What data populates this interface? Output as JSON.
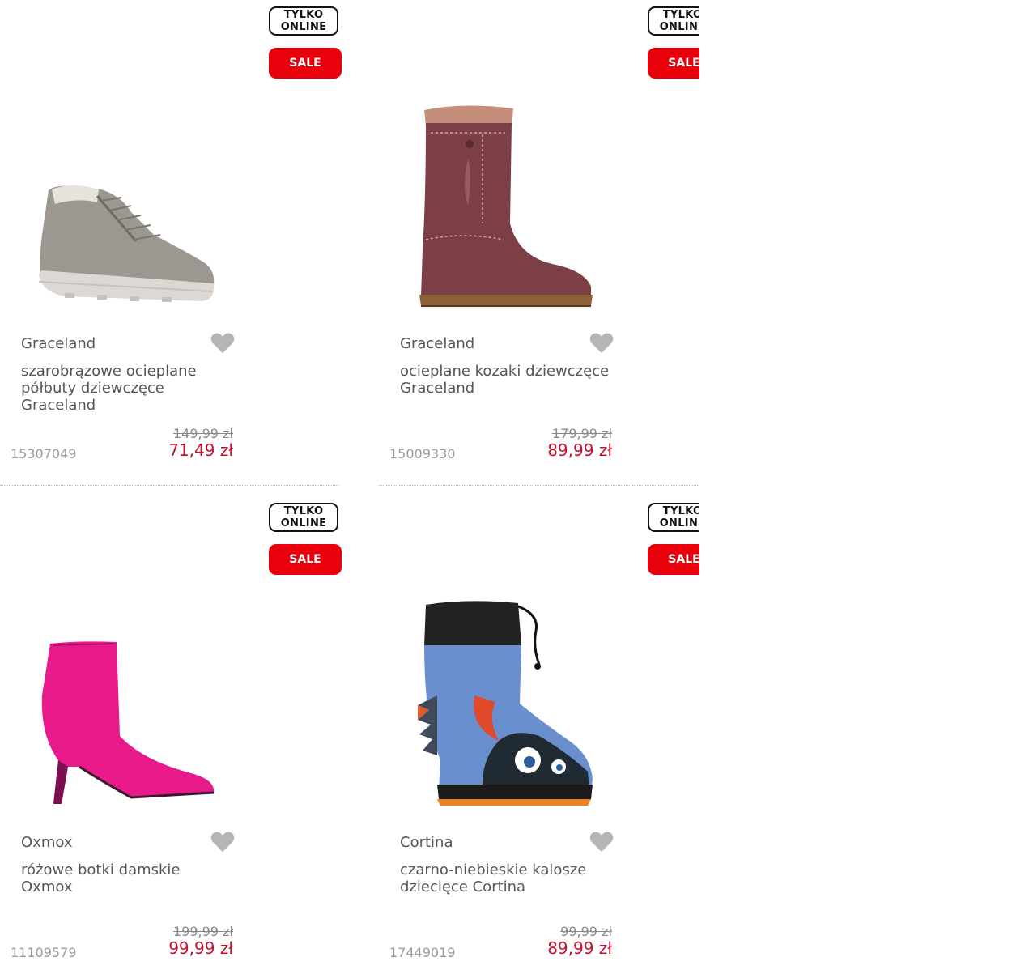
{
  "badges": {
    "online": [
      "TYLKO",
      "ONLINE"
    ],
    "sale": "SALE"
  },
  "products": [
    {
      "brand": "Graceland",
      "name": "szarobrązowe ocieplane półbuty dziewczęce Graceland",
      "old_price": "149,99 zł",
      "new_price": "71,49 zł",
      "sku": "15307049",
      "image": "grey-sneaker-image"
    },
    {
      "brand": "Graceland",
      "name": "ocieplane kozaki dziewczęce Graceland",
      "old_price": "179,99 zł",
      "new_price": "89,99 zł",
      "sku": "15009330",
      "image": "brown-boot-image"
    },
    {
      "brand": "Oxmox",
      "name": "różowe botki damskie Oxmox",
      "old_price": "199,99 zł",
      "new_price": "99,99 zł",
      "sku": "11109579",
      "image": "pink-ankle-boot-image"
    },
    {
      "brand": "Cortina",
      "name": "czarno-niebieskie kalosze dziecięce Cortina",
      "old_price": "99,99 zł",
      "new_price": "89,99 zł",
      "sku": "17449019",
      "image": "monster-rain-boot-image"
    }
  ],
  "colors": {
    "sale": "#e8000b",
    "price": "#c8102e",
    "heart": "#b5b5b5"
  }
}
